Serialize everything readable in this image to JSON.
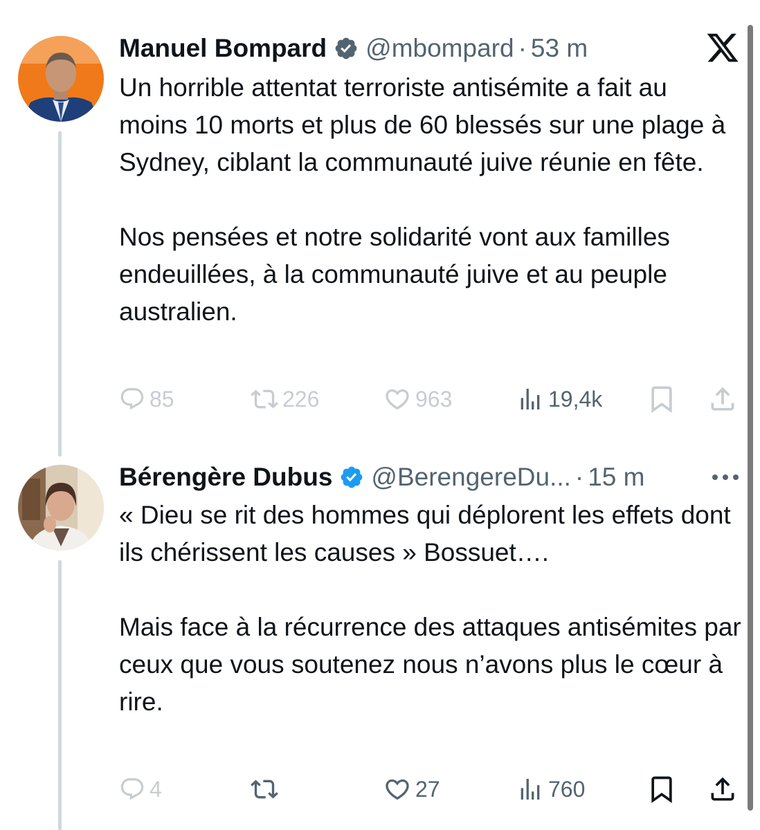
{
  "tweets": [
    {
      "author_name": "Manuel Bompard",
      "handle": "@mbompard",
      "separator": "·",
      "time": "53 m",
      "text_paragraphs": [
        "Un horrible attentat terroriste antisémite a fait au moins 10 morts et plus de 60 blessés sur une plage à Sydney, ciblant la communauté juive réunie en fête.",
        "Nos pensées et notre solidarité vont aux familles endeuillées, à la communauté juive et au peuple australien."
      ],
      "replies": "85",
      "reposts": "226",
      "likes": "963",
      "views": "19,4k",
      "top_right_icon": "x-logo-icon"
    },
    {
      "author_name": "Bérengère Dubus",
      "handle": "@BerengereDu...",
      "separator": "·",
      "time": "15 m",
      "text_paragraphs": [
        "« Dieu se rit des hommes qui déplorent les effets dont ils chérissent les causes » Bossuet….",
        "Mais face à la récurrence des attaques antisémites par ceux que vous soutenez  nous n’avons plus le cœur à rire."
      ],
      "replies": "4",
      "reposts": "",
      "likes": "27",
      "views": "760",
      "top_right_icon": "more-options-icon"
    }
  ],
  "colors": {
    "text": "#0f1419",
    "secondary": "#536471",
    "verified": "#1d9bf0",
    "thread_line": "#cfd9de"
  }
}
